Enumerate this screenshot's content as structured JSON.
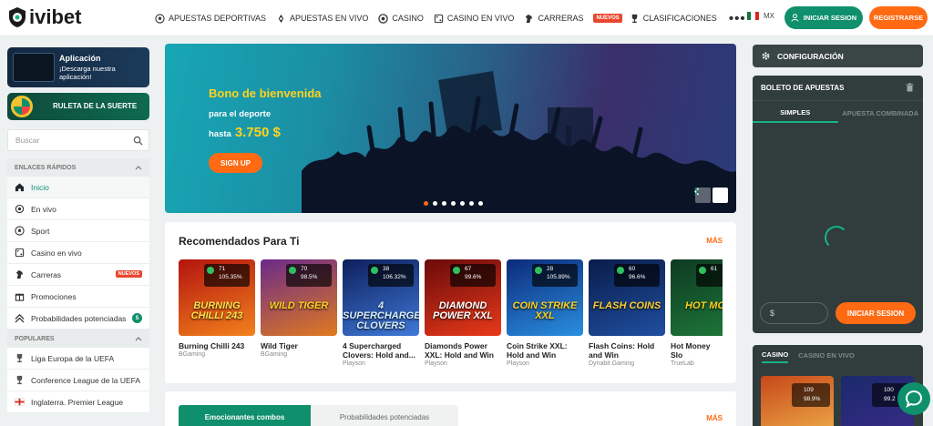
{
  "brand": {
    "name": "ivibet",
    "accent": "#0f8f6c",
    "orange": "#ff6a13"
  },
  "nav": {
    "items": [
      {
        "label": "Apuestas deportivas",
        "icon": "soccer-ball-icon"
      },
      {
        "label": "Apuestas en vivo",
        "icon": "live-icon"
      },
      {
        "label": "Casino",
        "icon": "chip-icon"
      },
      {
        "label": "Casino en vivo",
        "icon": "live-casino-icon"
      },
      {
        "label": "Carreras",
        "icon": "horse-icon",
        "badge": "Nuevos"
      },
      {
        "label": "Clasificaciones",
        "icon": "trophy-icon"
      }
    ],
    "more": "•••",
    "region": "MX",
    "login_label": "INICIAR SESION",
    "register_label": "REGISTRARSE"
  },
  "sidebar": {
    "app_promo": {
      "title": "Aplicación",
      "subtitle": "¡Descarga nuestra aplicación!"
    },
    "roulette_promo": {
      "title": "RULETA DE LA SUERTE"
    },
    "search_placeholder": "Buscar",
    "quick_links_title": "ENLACES RÁPIDOS",
    "quick_links": [
      {
        "label": "Inicio",
        "icon": "home-icon",
        "active": true
      },
      {
        "label": "En vivo",
        "icon": "live-icon"
      },
      {
        "label": "Sport",
        "icon": "soccer-ball-icon"
      },
      {
        "label": "Casino en vivo",
        "icon": "live-casino-icon"
      },
      {
        "label": "Carreras",
        "icon": "horse-icon",
        "badge": "Nuevos"
      },
      {
        "label": "Promociones",
        "icon": "gift-icon"
      },
      {
        "label": "Probabilidades potenciadas",
        "icon": "boost-icon",
        "count": "5"
      }
    ],
    "popular_title": "POPULARES",
    "popular": [
      {
        "label": "Liga Europa de la UEFA",
        "icon": "trophy-icon"
      },
      {
        "label": "Conference League de la UEFA",
        "icon": "trophy-icon"
      },
      {
        "label": "Inglaterra. Premier League",
        "icon": "england-flag-icon"
      }
    ]
  },
  "hero": {
    "title": "Bono de bienvenida",
    "line1": "para el deporte",
    "line2_prefix": "hasta",
    "amount": "3.750 $",
    "button": "SIGN UP",
    "slides": 7,
    "active_slide": 0
  },
  "recommended": {
    "title": "Recomendados Para Ti",
    "more": "MÁS",
    "games": [
      {
        "name": "Burning Chilli 243",
        "provider": "BGaming",
        "rank": "71",
        "rtp": "105.35%",
        "art": "BURNING CHILLI 243",
        "bg": "#b3130f",
        "bg2": "#f3821c",
        "fg": "#ffe34a"
      },
      {
        "name": "Wild Tiger",
        "provider": "BGaming",
        "rank": "70",
        "rtp": "98.5%",
        "art": "WILD TIGER",
        "bg": "#6a2a8a",
        "bg2": "#e07a1f",
        "fg": "#ffd21f"
      },
      {
        "name": "4 Supercharged Clovers: Hold and...",
        "provider": "Playson",
        "rank": "38",
        "rtp": "106.32%",
        "art": "4 SUPERCHARGED CLOVERS",
        "bg": "#0d1f5c",
        "bg2": "#3f79d8",
        "fg": "#d6f0ff"
      },
      {
        "name": "Diamonds Power XXL: Hold and Win",
        "provider": "Playson",
        "rank": "67",
        "rtp": "99.6%",
        "art": "DIAMOND POWER XXL",
        "bg": "#6a0a0a",
        "bg2": "#e93a1a",
        "fg": "#ffffff"
      },
      {
        "name": "Coin Strike XXL: Hold and Win",
        "provider": "Playson",
        "rank": "28",
        "rtp": "105.89%",
        "art": "COIN STRIKE XXL",
        "bg": "#0c2a7a",
        "bg2": "#2a8fe0",
        "fg": "#ffd21f"
      },
      {
        "name": "Flash Coins: Hold and Win",
        "provider": "Dynabit Gaming",
        "rank": "60",
        "rtp": "96.6%",
        "art": "FLASH COINS",
        "bg": "#0a1c4a",
        "bg2": "#1f4fa0",
        "fg": "#ffcf2a"
      },
      {
        "name": "Hot Money Slo",
        "provider": "TrueLab",
        "rank": "61",
        "rtp": "",
        "art": "HOT MON",
        "bg": "#0e3a22",
        "bg2": "#1e7a3a",
        "fg": "#ffd21f"
      }
    ]
  },
  "combos": {
    "tab_active": "Emocionantes combos",
    "tab_other": "Probabilidades potenciadas",
    "more": "MÁS"
  },
  "right": {
    "config_label": "CONFIGURACIÓN",
    "betslip_title": "BOLETO DE APUESTAS",
    "tab_single": "SIMPLES",
    "tab_combo": "APUESTA COMBINADA",
    "stake_placeholder": "$",
    "login_label": "INICIAR SESION",
    "casino_tab": "CASINO",
    "live_casino_tab": "CASINO EN VIVO",
    "mini_games": [
      {
        "rank": "109",
        "rtp": "98.9%",
        "bg": "#c7471a",
        "bg2": "#f0b24a"
      },
      {
        "rank": "100",
        "rtp": "99.2",
        "bg": "#1a2a6a",
        "bg2": "#3a2a8a"
      }
    ]
  }
}
